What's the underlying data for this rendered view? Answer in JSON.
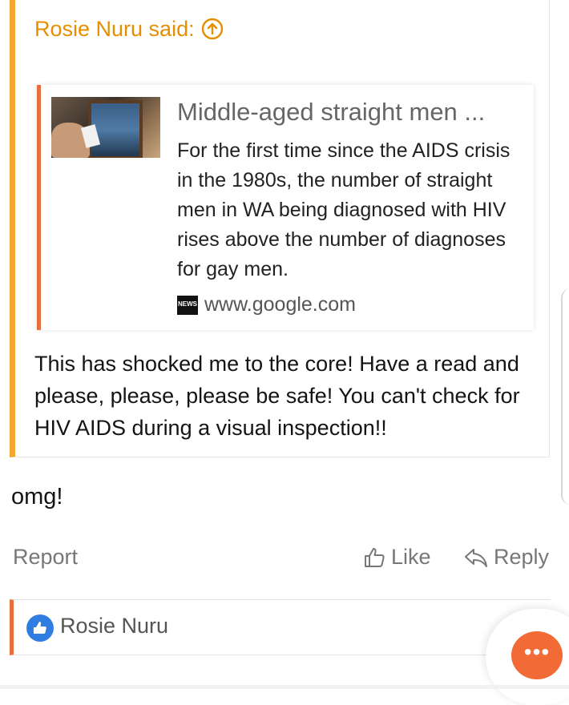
{
  "quote": {
    "attribution": "Rosie Nuru said:",
    "goto_icon": "arrow-up-circle-icon",
    "embed": {
      "title": "Middle-aged straight men ...",
      "description": "For the first time since the AIDS crisis in the 1980s, the number of straight men in WA being diagnosed with HIV rises above the number of diagnoses for gay men.",
      "source_logo": "NEWS",
      "source": "www.google.com"
    },
    "text": "This has shocked me to the core! Have a read and please, please, please be safe! You can't check for HIV AIDS during a visual inspection!!"
  },
  "post": {
    "text": "omg!"
  },
  "actions": {
    "report": "Report",
    "like": "Like",
    "reply": "Reply"
  },
  "likes": {
    "users": "Rosie Nuru"
  },
  "colors": {
    "quote_accent": "#f3a630",
    "attribution": "#e58f00",
    "embed_accent": "#e86e3c",
    "like_badge": "#2f7de1",
    "chat_fab": "#f26a35"
  }
}
